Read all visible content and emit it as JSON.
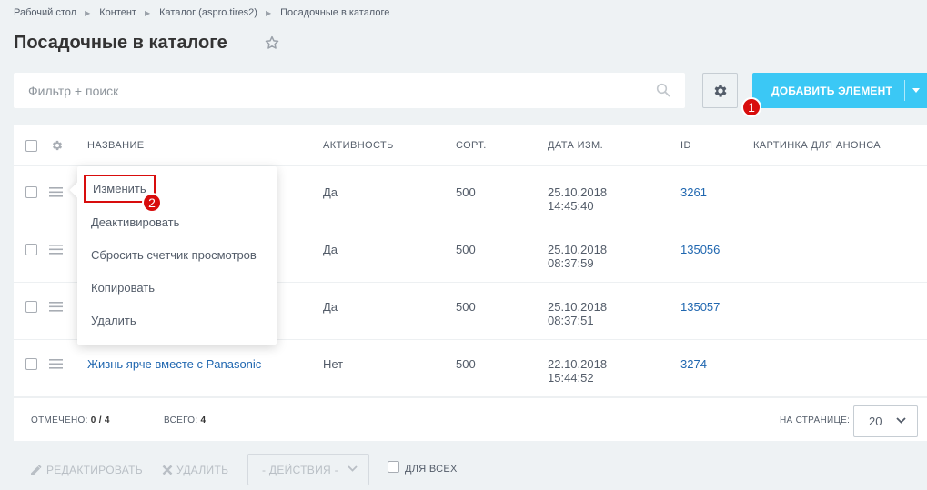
{
  "breadcrumb": [
    "Рабочий стол",
    "Контент",
    "Каталог (aspro.tires2)",
    "Посадочные в каталоге"
  ],
  "page_title": "Посадочные в каталоге",
  "filter": {
    "placeholder": "Фильтр + поиск"
  },
  "toolbar": {
    "add_label": "ДОБАВИТЬ ЭЛЕМЕНТ"
  },
  "markers": {
    "m1": "1",
    "m2": "2"
  },
  "columns": {
    "name": "НАЗВАНИЕ",
    "active": "АКТИВНОСТЬ",
    "sort": "СОРТ.",
    "date": "ДАТА ИЗМ.",
    "id": "ID",
    "image": "КАРТИНКА ДЛЯ АНОНСА"
  },
  "rows": [
    {
      "name": "",
      "active": "Да",
      "sort": "500",
      "date": "25.10.2018",
      "time": "14:45:40",
      "id": "3261"
    },
    {
      "name": "",
      "active": "Да",
      "sort": "500",
      "date": "25.10.2018",
      "time": "08:37:59",
      "id": "135056"
    },
    {
      "name": "",
      "active": "Да",
      "sort": "500",
      "date": "25.10.2018",
      "time": "08:37:51",
      "id": "135057"
    },
    {
      "name": "Жизнь ярче вместе с Panasonic",
      "active": "Нет",
      "sort": "500",
      "date": "22.10.2018",
      "time": "15:44:52",
      "id": "3274"
    }
  ],
  "context_menu": [
    "Изменить",
    "Деактивировать",
    "Сбросить счетчик просмотров",
    "Копировать",
    "Удалить"
  ],
  "footer": {
    "checked_label": "ОТМЕЧЕНО:",
    "checked_value": "0 / 4",
    "total_label": "ВСЕГО:",
    "total_value": "4",
    "per_page_label": "НА СТРАНИЦЕ:",
    "per_page_value": "20"
  },
  "action_bar": {
    "edit": "РЕДАКТИРОВАТЬ",
    "delete": "УДАЛИТЬ",
    "actions": "- ДЕЙСТВИЯ -",
    "for_all": "ДЛЯ ВСЕХ"
  },
  "colors": {
    "accent": "#3bc8f5",
    "link": "#2067b0",
    "marker": "#d80d0d"
  }
}
